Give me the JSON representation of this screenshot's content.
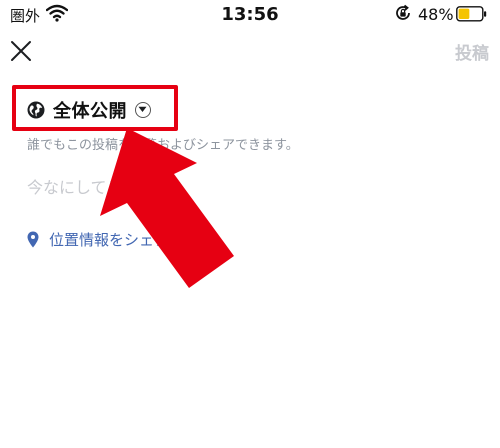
{
  "status_bar": {
    "carrier": "圏外",
    "time": "13:56",
    "battery_percent": "48%",
    "battery_level": 0.48
  },
  "header": {
    "post_label": "投稿"
  },
  "privacy": {
    "label": "全体公開",
    "description": "誰でもこの投稿を閲覧およびシェアできます。"
  },
  "composer": {
    "placeholder": "今なにしてる？"
  },
  "location": {
    "label": "位置情報をシェア"
  },
  "colors": {
    "annotation_red": "#e60012",
    "link_blue": "#4267b2",
    "battery_yellow": "#f5c400",
    "muted_gray": "#c8cacf"
  }
}
